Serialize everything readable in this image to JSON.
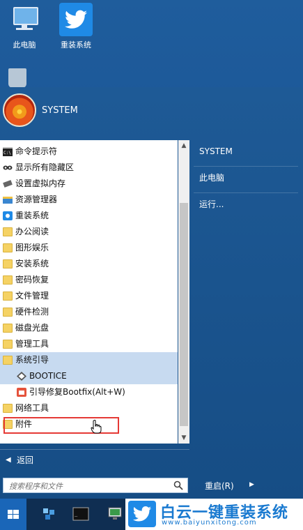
{
  "desktop": {
    "icons": [
      {
        "label": "此电脑",
        "icon": "computer-icon"
      },
      {
        "label": "重装系统",
        "icon": "twitter-bird-icon"
      }
    ]
  },
  "start_menu": {
    "user": {
      "name": "SYSTEM"
    },
    "programs": [
      {
        "label": "命令提示符",
        "icon": "cmd-icon"
      },
      {
        "label": "显示所有隐藏区",
        "icon": "eyes-icon"
      },
      {
        "label": "设置虚拟内存",
        "icon": "memory-icon"
      },
      {
        "label": "资源管理器",
        "icon": "folder-icon"
      },
      {
        "label": "重装系统",
        "icon": "twitter-bird-icon"
      },
      {
        "label": "办公阅读",
        "icon": "folder-icon"
      },
      {
        "label": "图形娱乐",
        "icon": "folder-icon"
      },
      {
        "label": "安装系统",
        "icon": "folder-icon"
      },
      {
        "label": "密码恢复",
        "icon": "folder-icon"
      },
      {
        "label": "文件管理",
        "icon": "folder-icon"
      },
      {
        "label": "硬件检测",
        "icon": "folder-icon"
      },
      {
        "label": "磁盘光盘",
        "icon": "folder-icon"
      },
      {
        "label": "管理工具",
        "icon": "folder-icon"
      },
      {
        "label": "系统引导",
        "icon": "folder-icon"
      },
      {
        "label": "BOOTICE",
        "icon": "bootice-icon"
      },
      {
        "label": "引导修复Bootfix(Alt+W)",
        "icon": "bootfix-icon"
      },
      {
        "label": "网络工具",
        "icon": "folder-icon"
      },
      {
        "label": "附件",
        "icon": "folder-icon"
      }
    ],
    "back_label": "返回",
    "search_placeholder": "搜索程序和文件",
    "right_items": [
      "SYSTEM",
      "此电脑",
      "运行..."
    ],
    "restart_label": "重启(R)"
  },
  "taskbar": {
    "brand_title": "白云一键重装系统",
    "brand_url": "www.baiyunxitong.com"
  },
  "colors": {
    "accent": "#1f8ae6",
    "highlight_border": "#e53935",
    "selected_bg": "#c7daf0"
  }
}
